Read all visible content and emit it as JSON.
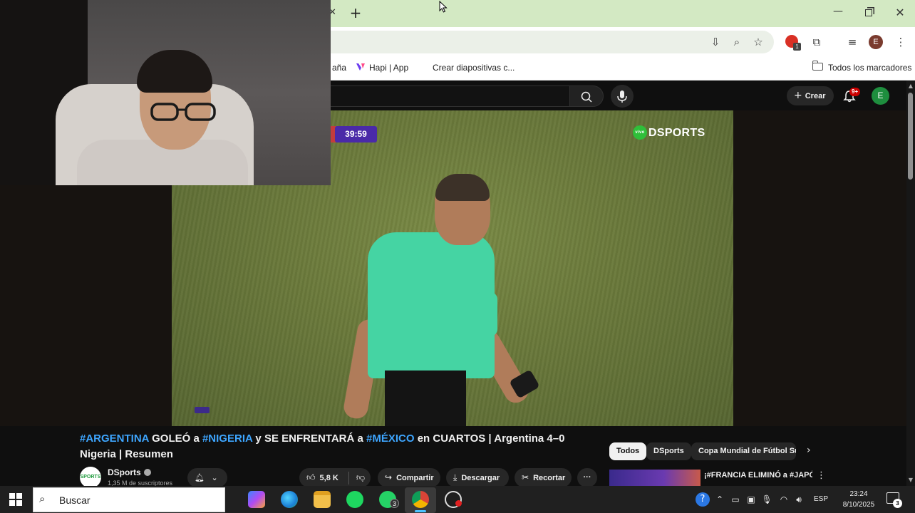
{
  "browser": {
    "bookmarks": [
      {
        "label": "aña"
      },
      {
        "label": "Hapi | App"
      },
      {
        "label": "Crear diapositivas c..."
      }
    ],
    "all_bookmarks_label": "Todos los marcadores",
    "profile_initial": "E",
    "extension_badge": "1"
  },
  "youtube": {
    "create_label": "Crear",
    "notification_count": "9+",
    "avatar_initial": "E",
    "video": {
      "timer": "39:59",
      "broadcaster_logo": "DSPORTS",
      "live_tag": "vivo",
      "title_parts": [
        {
          "text": "#ARGENTINA",
          "tag": true
        },
        {
          "text": " GOLEÓ a ",
          "tag": false
        },
        {
          "text": "#NIGERIA",
          "tag": true
        },
        {
          "text": " y SE ENFRENTARÁ a ",
          "tag": false
        },
        {
          "text": "#MÉXICO",
          "tag": true
        },
        {
          "text": " en CUARTOS | Argentina 4–0 Nigeria | Resumen",
          "tag": false
        }
      ]
    },
    "channel": {
      "avatar_text": "SPORTS",
      "name": "DSports",
      "subscribers": "1,35 M de suscriptores"
    },
    "actions": {
      "likes": "5,8 K",
      "share": "Compartir",
      "download": "Descargar",
      "clip": "Recortar"
    },
    "chips": [
      "Todos",
      "DSports",
      "Copa Mundial de Fútbol Sub-"
    ],
    "recommendation": {
      "title": "¡#FRANCIA ELIMINÓ a #JAPÓN con un PENAL EN EL ÚLTIMO"
    }
  },
  "taskbar": {
    "search_placeholder": "Buscar",
    "whatsapp_badge": "3",
    "language": "ESP",
    "time": "23:24",
    "date": "8/10/2025",
    "notification_count": "3"
  }
}
